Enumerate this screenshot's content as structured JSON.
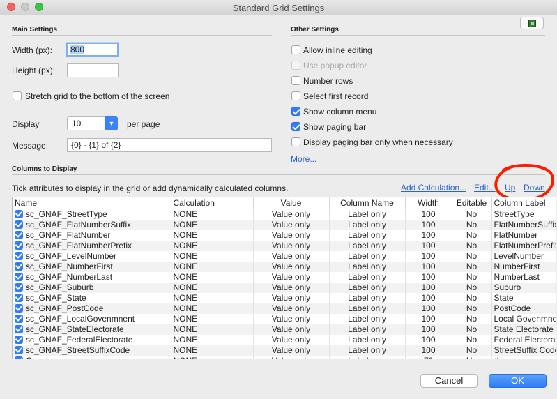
{
  "window": {
    "title": "Standard Grid Settings"
  },
  "main_settings": {
    "section_title": "Main Settings",
    "width_label": "Width (px):",
    "width_value": "800",
    "height_label": "Height (px):",
    "height_value": "",
    "stretch_label": "Stretch grid to the bottom of the screen",
    "display_label": "Display",
    "display_value": "10",
    "per_page_label": "per page",
    "message_label": "Message:",
    "message_value": "{0} - {1} of {2}"
  },
  "other_settings": {
    "section_title": "Other Settings",
    "options": [
      {
        "label": "Allow inline editing",
        "checked": false,
        "enabled": true
      },
      {
        "label": "Use popup editor",
        "checked": false,
        "enabled": false
      },
      {
        "label": "Number rows",
        "checked": false,
        "enabled": true
      },
      {
        "label": "Select first record",
        "checked": false,
        "enabled": true
      },
      {
        "label": "Show column menu",
        "checked": true,
        "enabled": true
      },
      {
        "label": "Show paging bar",
        "checked": true,
        "enabled": true
      },
      {
        "label": "Display paging bar only when necessary",
        "checked": false,
        "enabled": true
      }
    ],
    "more_link": "More..."
  },
  "columns_section": {
    "section_title": "Columns to Display",
    "instructions": "Tick attributes to display in the grid or add dynamically calculated columns.",
    "add_calculation": "Add Calculation...",
    "edit": "Edit...",
    "up": "Up",
    "down": "Down",
    "headers": [
      "Name",
      "Calculation",
      "Value",
      "Column Name",
      "Width",
      "Editable",
      "Column Label"
    ],
    "rows": [
      [
        "sc_GNAF_StreetType",
        "NONE",
        "Value only",
        "Label only",
        "100",
        "No",
        "StreetType"
      ],
      [
        "sc_GNAF_FlatNumberSuffix",
        "NONE",
        "Value only",
        "Label only",
        "100",
        "No",
        "FlatNumberSuffix"
      ],
      [
        "sc_GNAF_FlatNumber",
        "NONE",
        "Value only",
        "Label only",
        "100",
        "No",
        "FlatNumber"
      ],
      [
        "sc_GNAF_FlatNumberPrefix",
        "NONE",
        "Value only",
        "Label only",
        "100",
        "No",
        "FlatNumberPrefix"
      ],
      [
        "sc_GNAF_LevelNumber",
        "NONE",
        "Value only",
        "Label only",
        "100",
        "No",
        "LevelNumber"
      ],
      [
        "sc_GNAF_NumberFirst",
        "NONE",
        "Value only",
        "Label only",
        "100",
        "No",
        "NumberFirst"
      ],
      [
        "sc_GNAF_NumberLast",
        "NONE",
        "Value only",
        "Label only",
        "100",
        "No",
        "NumberLast"
      ],
      [
        "sc_GNAF_Suburb",
        "NONE",
        "Value only",
        "Label only",
        "100",
        "No",
        "Suburb"
      ],
      [
        "sc_GNAF_State",
        "NONE",
        "Value only",
        "Label only",
        "100",
        "No",
        "State"
      ],
      [
        "sc_GNAF_PostCode",
        "NONE",
        "Value only",
        "Label only",
        "100",
        "No",
        "PostCode"
      ],
      [
        "sc_GNAF_LocalGovenmnent",
        "NONE",
        "Value only",
        "Label only",
        "100",
        "No",
        "Local Govenmnent"
      ],
      [
        "sc_GNAF_StateElectorate",
        "NONE",
        "Value only",
        "Label only",
        "100",
        "No",
        "State Electorate"
      ],
      [
        "sc_GNAF_FederalElectorate",
        "NONE",
        "Value only",
        "Label only",
        "100",
        "No",
        "Federal Electorate"
      ],
      [
        "sc_GNAF_StreetSuffixCode",
        "NONE",
        "Value only",
        "Label only",
        "100",
        "No",
        "StreetSuffix Code"
      ],
      [
        "Counter",
        "NONE",
        "Value only",
        "Label only",
        "70",
        "No",
        "#"
      ]
    ]
  },
  "buttons": {
    "cancel": "Cancel",
    "ok": "OK"
  },
  "colors": {
    "accent": "#2f7cf6",
    "link": "#2a63c8",
    "annotation": "#ff1a00"
  },
  "icons": {
    "toolbar": "film-strip-icon"
  }
}
